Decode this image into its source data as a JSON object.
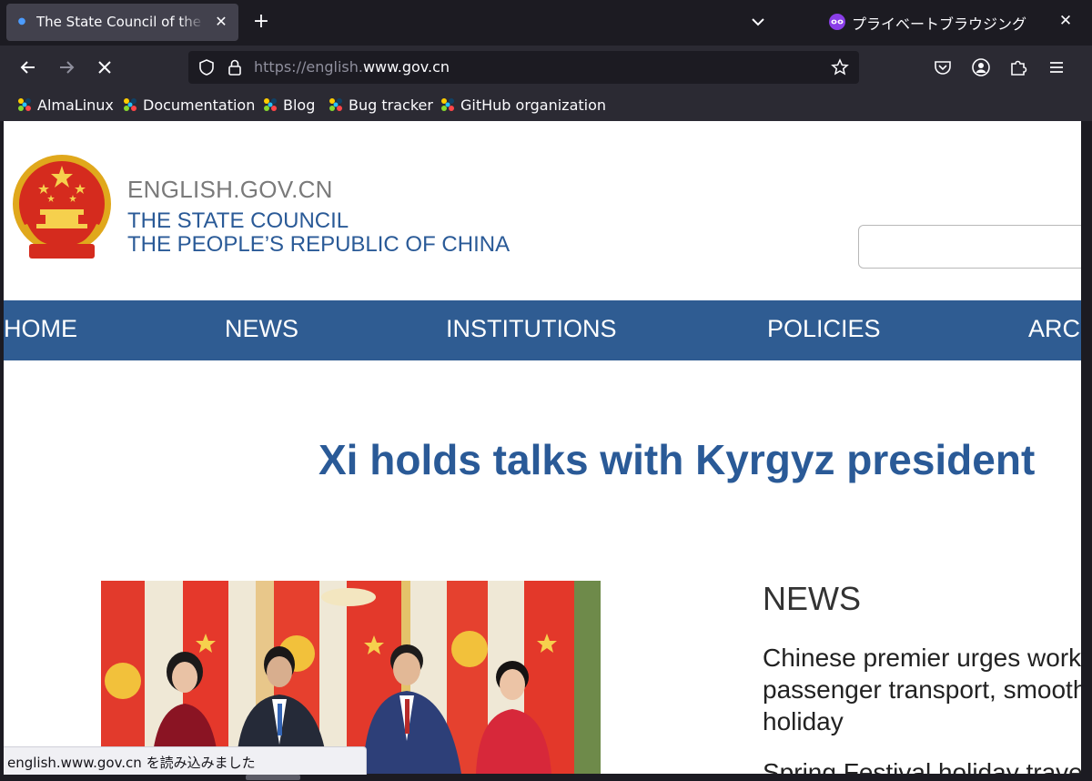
{
  "browser": {
    "tab": {
      "title": "The State Council of the People's Republic of China"
    },
    "private_label": "プライベートブラウジング",
    "url": {
      "scheme": "https://",
      "subdomain": "english.",
      "domain": "www.gov.cn"
    },
    "bookmarks": [
      {
        "label": "AlmaLinux"
      },
      {
        "label": "Documentation"
      },
      {
        "label": "Blog"
      },
      {
        "label": "Bug tracker"
      },
      {
        "label": "GitHub organization"
      }
    ],
    "status_text": "english.www.gov.cn を読み込みました"
  },
  "site": {
    "domain_label": "ENGLISH.GOV.CN",
    "name_line1": "THE STATE COUNCIL",
    "name_line2": "THE PEOPLE’S REPUBLIC OF CHINA",
    "search": {
      "placeholder": ""
    },
    "nav": [
      "HOME",
      "NEWS",
      "INSTITUTIONS",
      "POLICIES",
      "ARCHIVE"
    ],
    "headline": "Xi holds talks with Kyrgyz president",
    "news": {
      "heading": "NEWS",
      "item1": "Chinese premier urges work passenger transport, smooth holiday",
      "item2": "Spring Festival holiday traveler"
    }
  },
  "colors": {
    "brand_blue": "#2a5a97",
    "nav_bg": "#2f5c92",
    "browser_chrome": "#2b2a33",
    "tab_bg": "#1c1b22"
  }
}
